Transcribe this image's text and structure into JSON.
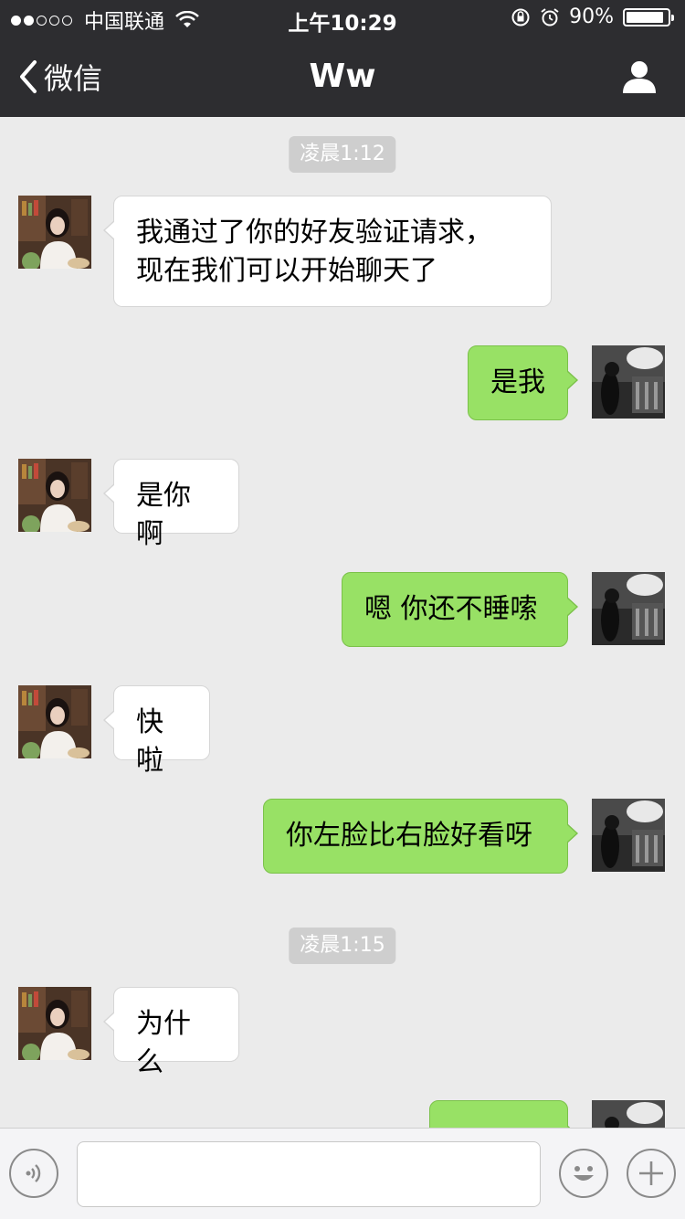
{
  "status_bar": {
    "carrier": "中国联通",
    "time": "上午10:29",
    "battery": "90%",
    "battery_level": 0.9,
    "signal_bars_filled": 2,
    "signal_bars_total": 5
  },
  "nav": {
    "back_label": "微信",
    "title": "Ww"
  },
  "messages": [
    {
      "type": "time",
      "text": "凌晨1:12"
    },
    {
      "type": "in",
      "text": "我通过了你的好友验证请求，\n现在我们可以开始聊天了"
    },
    {
      "type": "out",
      "text": "是我"
    },
    {
      "type": "in",
      "text": "是你啊"
    },
    {
      "type": "out",
      "text": "嗯 你还不睡嗦"
    },
    {
      "type": "in",
      "text": "快啦"
    },
    {
      "type": "out",
      "text": "你左脸比右脸好看呀"
    },
    {
      "type": "time",
      "text": "凌晨1:15"
    },
    {
      "type": "in",
      "text": "为什么"
    },
    {
      "type": "out",
      "text": ""
    }
  ],
  "input": {
    "value": "",
    "placeholder": ""
  },
  "colors": {
    "bar_background": "#2d2d30",
    "chat_background": "#ebebeb",
    "outgoing_bubble": "#98e165",
    "incoming_bubble": "#ffffff",
    "timestamp_background": "#cecece"
  },
  "icons": {
    "back": "chevron-left-icon",
    "profile": "person-icon",
    "voice": "voice-icon",
    "emoji": "emoji-icon",
    "add": "plus-icon"
  }
}
